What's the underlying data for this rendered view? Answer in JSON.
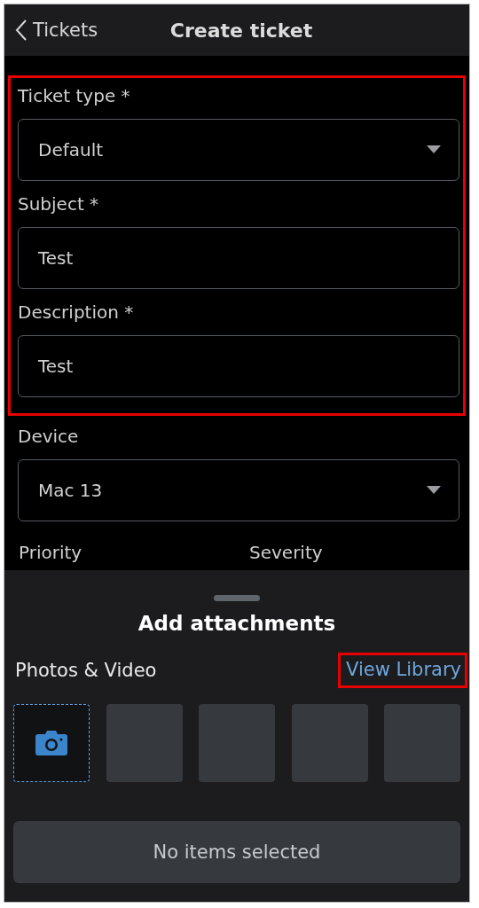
{
  "header": {
    "back_label": "Tickets",
    "title": "Create ticket"
  },
  "form_sections": [
    {
      "highlighted": true,
      "fields": [
        {
          "kind": "select",
          "label": "Ticket type *",
          "value": "Default"
        },
        {
          "kind": "text",
          "label": "Subject *",
          "value": "Test"
        },
        {
          "kind": "text",
          "label": "Description *",
          "value": "Test"
        }
      ]
    },
    {
      "highlighted": false,
      "fields": [
        {
          "kind": "select",
          "label": "Device",
          "value": "Mac 13"
        }
      ]
    }
  ],
  "partial_labels": [
    "Priority",
    "Severity"
  ],
  "attachments": {
    "title": "Add attachments",
    "section_label": "Photos & Video",
    "library_link": {
      "label": "View Library",
      "highlighted": true
    },
    "slots": [
      {
        "kind": "camera"
      },
      {
        "kind": "empty"
      },
      {
        "kind": "empty"
      },
      {
        "kind": "empty"
      },
      {
        "kind": "empty"
      }
    ],
    "status_button": "No items selected"
  }
}
